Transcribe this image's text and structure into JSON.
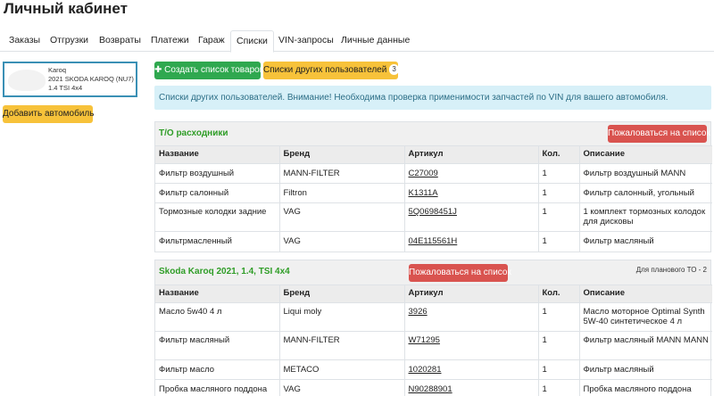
{
  "page_title": "Личный кабинет",
  "tabs": [
    {
      "label": "Заказы"
    },
    {
      "label": "Отгрузки"
    },
    {
      "label": "Возвраты"
    },
    {
      "label": "Платежи"
    },
    {
      "label": "Гараж"
    },
    {
      "label": "Списки"
    },
    {
      "label": "VIN-запросы"
    },
    {
      "label": "Личные данные"
    }
  ],
  "active_tab": "Списки",
  "car": {
    "model": "Karoq",
    "name": "2021 SKODA KAROQ (NU7)",
    "engine": "1.4 TSI 4x4"
  },
  "buttons": {
    "add_car": "Добавить автомобиль",
    "create_list": "Создать список товаров",
    "other_lists": "Списки других пользователей",
    "other_lists_count": "3",
    "complain": "Пожаловаться на список"
  },
  "info_text": "Списки других пользователей. Внимание! Необходима проверка применимости запчастей по VIN для вашего автомобиля.",
  "columns": [
    "Название",
    "Бренд",
    "Артикул",
    "Кол.",
    "Описание"
  ],
  "lists": [
    {
      "title": "Т/О расходники",
      "note": "",
      "rows": [
        {
          "name": "Фильтр воздушный",
          "brand": "MANN-FILTER",
          "article": "C27009",
          "qty": "1",
          "desc": "Фильтр воздушный MANN"
        },
        {
          "name": "Фильтр салонный",
          "brand": "Filtron",
          "article": "K1311A",
          "qty": "1",
          "desc": "Фильтр салонный, угольный"
        },
        {
          "name": "Тормозные колодки задние",
          "brand": "VAG",
          "article": "5Q0698451J",
          "qty": "1",
          "desc": "1 комплект тормозных колодок для дисковы"
        },
        {
          "name": "Фильтрмасленный",
          "brand": "VAG",
          "article": "04E115561H",
          "qty": "1",
          "desc": "Фильтр масляный"
        }
      ]
    },
    {
      "title": "Skoda Karoq 2021, 1.4, TSI 4x4",
      "note": "Для планового ТО - 2",
      "rows": [
        {
          "name": "Масло 5w40 4 л",
          "brand": "Liqui moly",
          "article": "3926",
          "qty": "1",
          "desc": "Масло моторное Optimal Synth 5W-40 синтетическое 4 л"
        },
        {
          "name": "Фильтр масляный",
          "brand": "MANN-FILTER",
          "article": "W71295",
          "qty": "1",
          "desc": "Фильтр масляный MANN MANN"
        },
        {
          "name": "Фильтр масло",
          "brand": "METACO",
          "article": "1020281",
          "qty": "1",
          "desc": "Фильтр масляный"
        },
        {
          "name": "Пробка масляного поддона",
          "brand": "VAG",
          "article": "N90288901",
          "qty": "1",
          "desc": "Пробка масляного поддона"
        }
      ]
    }
  ],
  "colors": {
    "accent_yellow": "#f7c23a",
    "green": "#2fa84f",
    "red": "#d9534f",
    "info_bg": "#d7f0f8",
    "list_title": "#2f9d27",
    "card_border": "#3a90b5"
  }
}
